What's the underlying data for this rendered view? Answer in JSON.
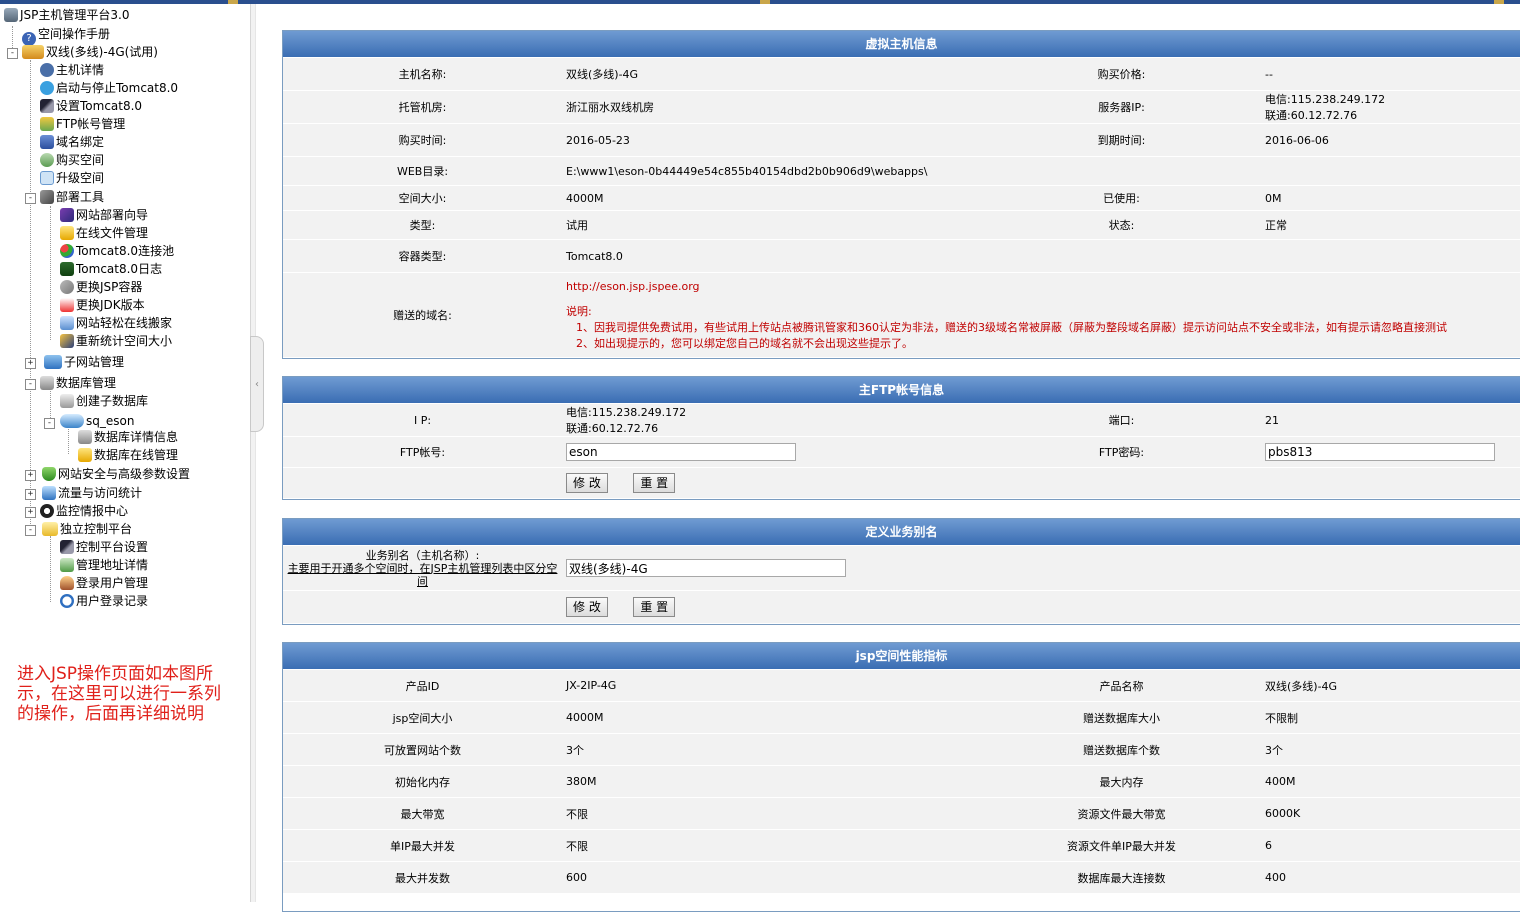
{
  "sidebar": {
    "root": "JSP主机管理平台3.0",
    "manual": "空间操作手册",
    "host": "双线(多线)-4G(试用)",
    "host_items": [
      "主机详情",
      "启动与停止Tomcat8.0",
      "设置Tomcat8.0",
      "FTP帐号管理",
      "域名绑定",
      "购买空间",
      "升级空间"
    ],
    "deploy": "部署工具",
    "deploy_items": [
      "网站部署向导",
      "在线文件管理",
      "Tomcat8.0连接池",
      "Tomcat8.0日志",
      "更换JSP容器",
      "更换JDK版本",
      "网站轻松在线搬家",
      "重新统计空间大小"
    ],
    "subsite": "子网站管理",
    "db": "数据库管理",
    "db_create": "创建子数据库",
    "db_name": "sq_eson",
    "db_items": [
      "数据库详情信息",
      "数据库在线管理"
    ],
    "security": "网站安全与高级参数设置",
    "traffic": "流量与访问统计",
    "monitor": "监控情报中心",
    "control": "独立控制平台",
    "control_items": [
      "控制平台设置",
      "管理地址详情",
      "登录用户管理",
      "用户登录记录"
    ],
    "note": "进入JSP操作页面如本图所示，在这里可以进行一系列的操作，后面再详细说明"
  },
  "vhost": {
    "title": "虚拟主机信息",
    "name_label": "主机名称:",
    "name": "双线(多线)-4G",
    "price_label": "购买价格:",
    "price": "--",
    "room_label": "托管机房:",
    "room": "浙江丽水双线机房",
    "ip_label": "服务器IP:",
    "ip_telecom": "电信:115.238.249.172",
    "ip_unicom": "联通:60.12.72.76",
    "buy_label": "购买时间:",
    "buy": "2016-05-23",
    "expire_label": "到期时间:",
    "expire": "2016-06-06",
    "web_label": "WEB目录:",
    "web": "E:\\www1\\eson-0b44449e54c855b40154dbd2b0b906d9\\webapps\\",
    "size_label": "空间大小:",
    "size": "4000M",
    "used_label": "已使用:",
    "used": "0M",
    "type_label": "类型:",
    "type": "试用",
    "status_label": "状态:",
    "status": "正常",
    "container_label": "容器类型:",
    "container": "Tomcat8.0",
    "domain_label": "赠送的域名:",
    "domain": "http://eson.jsp.jspee.org",
    "note_title": "说明:",
    "note1": "1、因我司提供免费试用，有些试用上传站点被腾讯管家和360认定为非法，赠送的3级域名常被屏蔽（屏蔽为整段域名屏蔽）提示访问站点不安全或非法，如有提示请忽略直接测试",
    "note2": "2、如出现提示的，您可以绑定您自己的域名就不会出现这些提示了。"
  },
  "ftp": {
    "title": "主FTP帐号信息",
    "ip_label": "I P:",
    "ip_telecom": "电信:115.238.249.172",
    "ip_unicom": "联通:60.12.72.76",
    "port_label": "端口:",
    "port": "21",
    "account_label": "FTP帐号:",
    "account": "eson",
    "password_label": "FTP密码:",
    "password": "pbs813",
    "modify": "修 改",
    "reset": "重 置"
  },
  "alias": {
    "title": "定义业务别名",
    "label1": "业务别名（主机名称）:",
    "label2": "主要用于开通多个空间时，在JSP主机管理列表中区分空间",
    "value": "双线(多线)-4G",
    "modify": "修 改",
    "reset": "重 置"
  },
  "perf": {
    "title": "jsp空间性能指标",
    "rows": [
      {
        "l1": "产品ID",
        "v1": "JX-2IP-4G",
        "l2": "产品名称",
        "v2": "双线(多线)-4G"
      },
      {
        "l1": "jsp空间大小",
        "v1": "4000M",
        "l2": "赠送数据库大小",
        "v2": "不限制"
      },
      {
        "l1": "可放置网站个数",
        "v1": "3个",
        "l2": "赠送数据库个数",
        "v2": "3个"
      },
      {
        "l1": "初始化内存",
        "v1": "380M",
        "l2": "最大内存",
        "v2": "400M"
      },
      {
        "l1": "最大带宽",
        "v1": "不限",
        "l2": "资源文件最大带宽",
        "v2": "6000K"
      },
      {
        "l1": "单IP最大并发",
        "v1": "不限",
        "l2": "资源文件单IP最大并发",
        "v2": "6"
      },
      {
        "l1": "最大并发数",
        "v1": "600",
        "l2": "数据库最大连接数",
        "v2": "400"
      }
    ]
  }
}
